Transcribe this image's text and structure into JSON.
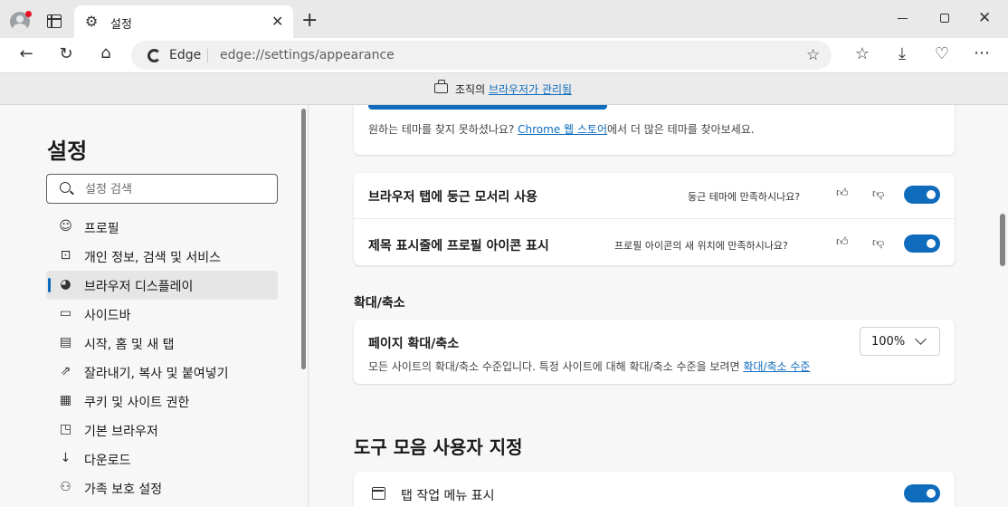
{
  "tab": {
    "title": "설정"
  },
  "omnibox": {
    "label": "Edge",
    "url": "edge://settings/appearance"
  },
  "infobar": {
    "prefix": "조직의 ",
    "link": "브라우저가 관리됨"
  },
  "sidebar": {
    "title": "설정",
    "search_placeholder": "설정 검색",
    "items": [
      {
        "label": "프로필",
        "icon": "profile-icon"
      },
      {
        "label": "개인 정보, 검색 및 서비스",
        "icon": "lock-icon"
      },
      {
        "label": "브라우저 디스플레이",
        "icon": "palette-icon",
        "active": true
      },
      {
        "label": "사이드바",
        "icon": "sidebar-icon"
      },
      {
        "label": "시작, 홈 및 새 탭",
        "icon": "home-tab-icon"
      },
      {
        "label": "잘라내기, 복사 및 붙여넣기",
        "icon": "share-icon"
      },
      {
        "label": "쿠키 및 사이트 권한",
        "icon": "cookie-icon"
      },
      {
        "label": "기본 브라우저",
        "icon": "default-browser-icon"
      },
      {
        "label": "다운로드",
        "icon": "download-icon"
      },
      {
        "label": "가족 보호 설정",
        "icon": "family-icon"
      }
    ]
  },
  "main": {
    "theme": {
      "hint_prefix": "원하는 테마를 찾지 못하셨나요? ",
      "hint_link": "Chrome 웹 스토어",
      "hint_suffix": "에서 더 많은 테마를 찾아보세요."
    },
    "appearance_rows": [
      {
        "title": "브라우저 탭에 둥근 모서리 사용",
        "feedback": "둥근 테마에 만족하시나요?",
        "enabled": true
      },
      {
        "title": "제목 표시줄에 프로필 아이콘 표시",
        "feedback": "프로필 아이콘의 새 위치에 만족하시나요?",
        "enabled": true
      }
    ],
    "zoom": {
      "section_title": "확대/축소",
      "row_title": "페이지 확대/축소",
      "desc_prefix": "모든 사이트의 확대/축소 수준입니다. 특정 사이트에 대해 확대/축소 수준을 보려면 ",
      "desc_link": "확대/축소 수준",
      "value": "100%"
    },
    "toolbar_section": {
      "title": "도구 모음 사용자 지정",
      "first_row": {
        "title": "탭 작업 메뉴 표시",
        "enabled": true
      }
    }
  },
  "colors": {
    "accent": "#0f6cbd",
    "active_nav": "#e6e6e6",
    "profile_badge": "#e81123"
  }
}
